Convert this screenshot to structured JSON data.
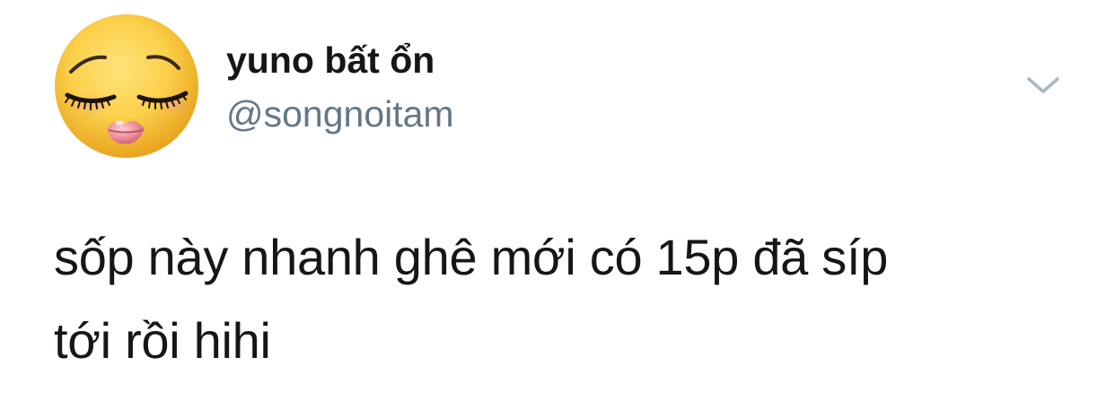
{
  "author": {
    "display_name": "yuno bất ổn",
    "handle": "@songnoitam",
    "avatar_icon": "kissing-face-emoji-icon"
  },
  "menu": {
    "icon": "chevron-down-icon"
  },
  "tweet": {
    "text": "sốp này nhanh ghê mới có 15p đã síp\ntới rồi hihi"
  },
  "colors": {
    "name": "#14171a",
    "handle": "#657786",
    "caret": "#aab8c2",
    "emoji_face": "#f7c53b",
    "lips": "#e8818f"
  }
}
